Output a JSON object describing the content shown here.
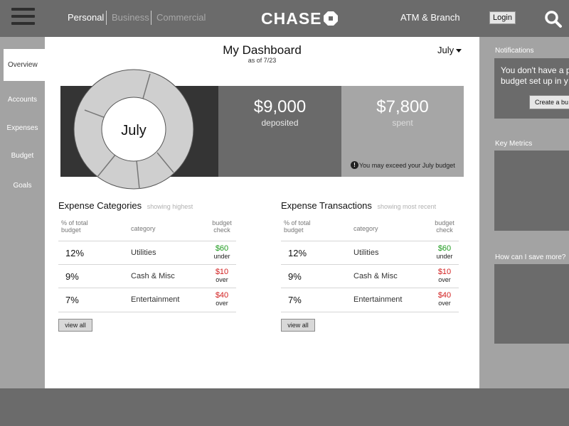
{
  "header": {
    "segments": [
      "Personal",
      "Business",
      "Commercial"
    ],
    "logo_text": "CHASE",
    "atm_label": "ATM & Branch",
    "login_label": "Login",
    "icons": [
      "hamburger-menu-icon",
      "chase-octagon-logo",
      "search-icon"
    ]
  },
  "leftnav": {
    "items": [
      "Overview",
      "Accounts",
      "Expenses",
      "Budget",
      "Goals"
    ],
    "active": "Overview"
  },
  "main": {
    "title": "My Dashboard",
    "as_of": "as of 7/23",
    "month_selector": "July",
    "donut_label": "July",
    "deposited": {
      "amount": "$9,000",
      "label": "deposited"
    },
    "spent": {
      "amount": "$7,800",
      "label": "spent"
    },
    "warning": "You may exceed your July budget",
    "categories": {
      "title": "Expense Categories",
      "hint": "showing highest",
      "col_pct": "% of total budget",
      "col_category": "category",
      "col_check": "budget check",
      "rows": [
        {
          "pct": "12%",
          "category": "Utilities",
          "amount": "$60",
          "state": "under"
        },
        {
          "pct": "9%",
          "category": "Cash & Misc",
          "amount": "$10",
          "state": "over"
        },
        {
          "pct": "7%",
          "category": "Entertainment",
          "amount": "$40",
          "state": "over"
        }
      ],
      "view_all": "view all"
    },
    "transactions": {
      "title": "Expense Transactions",
      "hint": "showing most recent",
      "col_pct": "% of total budget",
      "col_category": "category",
      "col_check": "budget check",
      "rows": [
        {
          "pct": "12%",
          "category": "Utilities",
          "amount": "$60",
          "state": "under"
        },
        {
          "pct": "9%",
          "category": "Cash & Misc",
          "amount": "$10",
          "state": "over"
        },
        {
          "pct": "7%",
          "category": "Entertainment",
          "amount": "$40",
          "state": "over"
        }
      ],
      "view_all": "view all"
    }
  },
  "right": {
    "notifications_label": "Notifications",
    "notif_line1": "You don't have a p",
    "notif_line2": "budget set up in y",
    "create_button": "Create a bu",
    "key_metrics_label": "Key Metrics",
    "save_label": "How can I save more?"
  },
  "colors": {
    "under": "#1e9a1e",
    "over": "#d22020",
    "chrome": "#6b6b6b",
    "side_panel": "#a3a3a3"
  }
}
